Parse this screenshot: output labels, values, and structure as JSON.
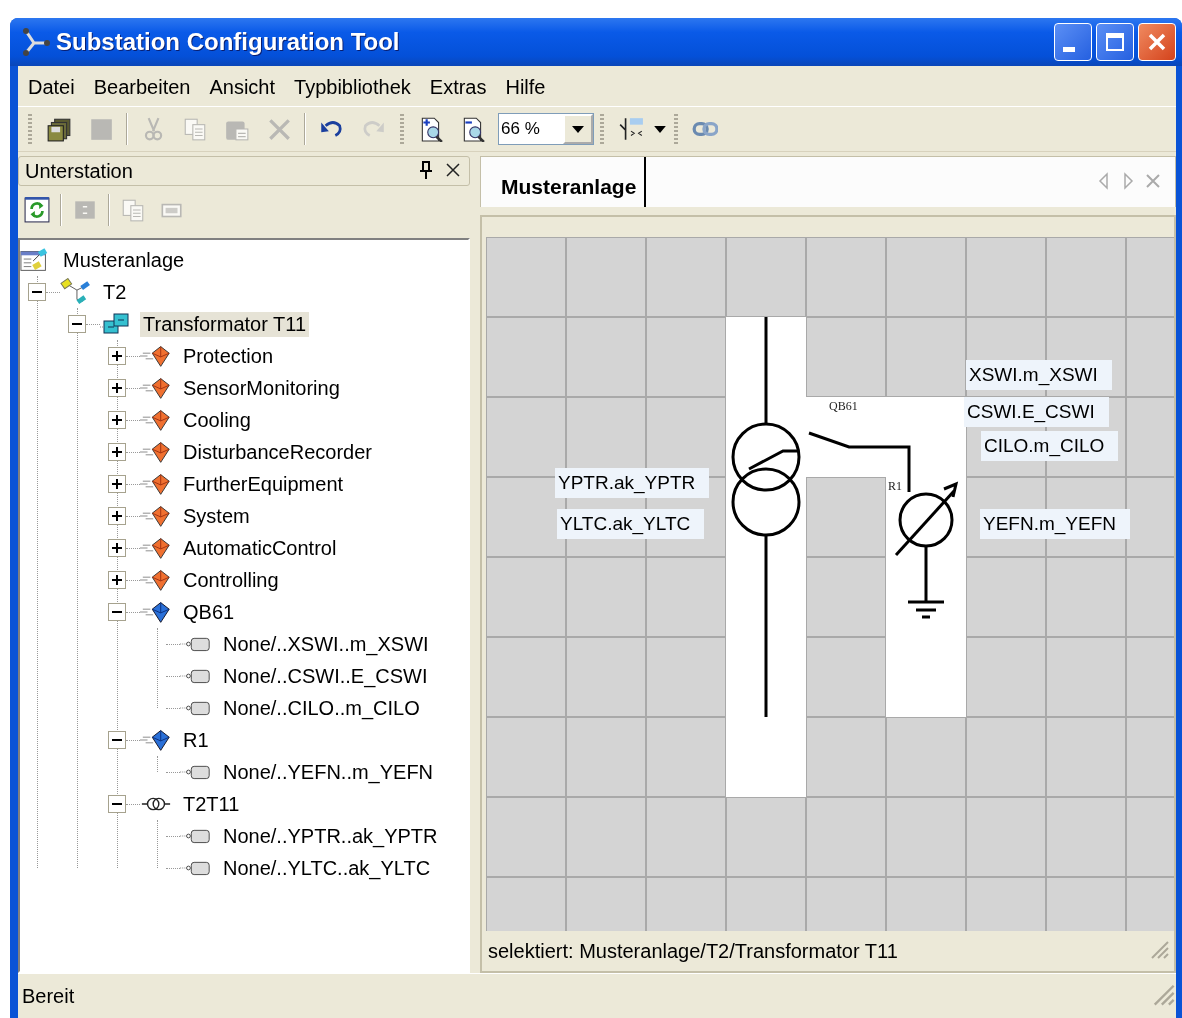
{
  "window": {
    "title": "Substation Configuration Tool"
  },
  "menu": [
    "Datei",
    "Bearbeiten",
    "Ansicht",
    "Typbibliothek",
    "Extras",
    "Hilfe"
  ],
  "toolbar": [
    {
      "kind": "save_all",
      "disabled": false
    },
    {
      "kind": "save",
      "disabled": true
    },
    {
      "kind": "separator"
    },
    {
      "kind": "cut",
      "disabled": true
    },
    {
      "kind": "copy",
      "disabled": true
    },
    {
      "kind": "paste",
      "disabled": true
    },
    {
      "kind": "delete",
      "disabled": true
    },
    {
      "kind": "separator"
    },
    {
      "kind": "undo",
      "disabled": false
    },
    {
      "kind": "redo",
      "disabled": true
    },
    {
      "kind": "grip"
    },
    {
      "kind": "zoom_in",
      "disabled": false
    },
    {
      "kind": "zoom_out",
      "disabled": false
    },
    {
      "kind": "zoom_box",
      "value": "66 %"
    },
    {
      "kind": "grip"
    },
    {
      "kind": "view_switch",
      "disabled": false
    },
    {
      "kind": "dropdown",
      "disabled": false
    },
    {
      "kind": "grip"
    },
    {
      "kind": "link",
      "disabled": false
    }
  ],
  "panel": {
    "title": "Unterstation",
    "tools": [
      {
        "kind": "refresh",
        "disabled": false
      },
      {
        "kind": "separator"
      },
      {
        "kind": "collapse",
        "disabled": true
      },
      {
        "kind": "separator"
      },
      {
        "kind": "copy",
        "disabled": true
      },
      {
        "kind": "frame",
        "disabled": true
      }
    ],
    "tree": [
      {
        "label": "Musteranlage",
        "kind": "substation",
        "selected": false,
        "children": [
          {
            "label": "T2",
            "kind": "bay",
            "expanded": true,
            "selected": false,
            "children": [
              {
                "label": "Transformator T11",
                "kind": "transformer",
                "expanded": true,
                "selected": true,
                "children": [
                  {
                    "label": "Protection",
                    "kind": "function",
                    "expanded": false,
                    "selected": false
                  },
                  {
                    "label": "SensorMonitoring",
                    "kind": "function",
                    "expanded": false,
                    "selected": false
                  },
                  {
                    "label": "Cooling",
                    "kind": "function",
                    "expanded": false,
                    "selected": false
                  },
                  {
                    "label": "DisturbanceRecorder",
                    "kind": "function",
                    "expanded": false,
                    "selected": false
                  },
                  {
                    "label": "FurtherEquipment",
                    "kind": "function",
                    "expanded": false,
                    "selected": false
                  },
                  {
                    "label": "System",
                    "kind": "function",
                    "expanded": false,
                    "selected": false
                  },
                  {
                    "label": "AutomaticControl",
                    "kind": "function",
                    "expanded": false,
                    "selected": false
                  },
                  {
                    "label": "Controlling",
                    "kind": "function",
                    "expanded": false,
                    "selected": false
                  },
                  {
                    "label": "QB61",
                    "kind": "equipment",
                    "expanded": true,
                    "selected": false,
                    "children": [
                      {
                        "label": "None/..XSWI..m_XSWI",
                        "kind": "lnode",
                        "selected": false
                      },
                      {
                        "label": "None/..CSWI..E_CSWI",
                        "kind": "lnode",
                        "selected": false
                      },
                      {
                        "label": "None/..CILO..m_CILO",
                        "kind": "lnode",
                        "selected": false
                      }
                    ]
                  },
                  {
                    "label": "R1",
                    "kind": "equipment",
                    "expanded": true,
                    "selected": false,
                    "children": [
                      {
                        "label": "None/..YEFN..m_YEFN",
                        "kind": "lnode",
                        "selected": false
                      }
                    ]
                  },
                  {
                    "label": "T2T11",
                    "kind": "winding",
                    "expanded": true,
                    "selected": false,
                    "children": [
                      {
                        "label": "None/..YPTR..ak_YPTR",
                        "kind": "lnode",
                        "selected": false
                      },
                      {
                        "label": "None/..YLTC..ak_YLTC",
                        "kind": "lnode",
                        "selected": false
                      }
                    ]
                  }
                ]
              }
            ]
          }
        ]
      }
    ]
  },
  "document": {
    "tabs": [
      {
        "label": "Musteranlage",
        "selected": true
      }
    ],
    "diagram": {
      "device_labels": [
        "QB61",
        "R1"
      ],
      "node_labels": [
        "XSWI.m_XSWI",
        "CSWI.E_CSWI",
        "CILO.m_CILO",
        "YPTR.ak_YPTR",
        "YLTC.ak_YLTC",
        "YEFN.m_YEFN"
      ]
    },
    "status": "selektiert: Musteranlage/T2/Transformator T11"
  },
  "status_bar": {
    "text": "Bereit"
  }
}
